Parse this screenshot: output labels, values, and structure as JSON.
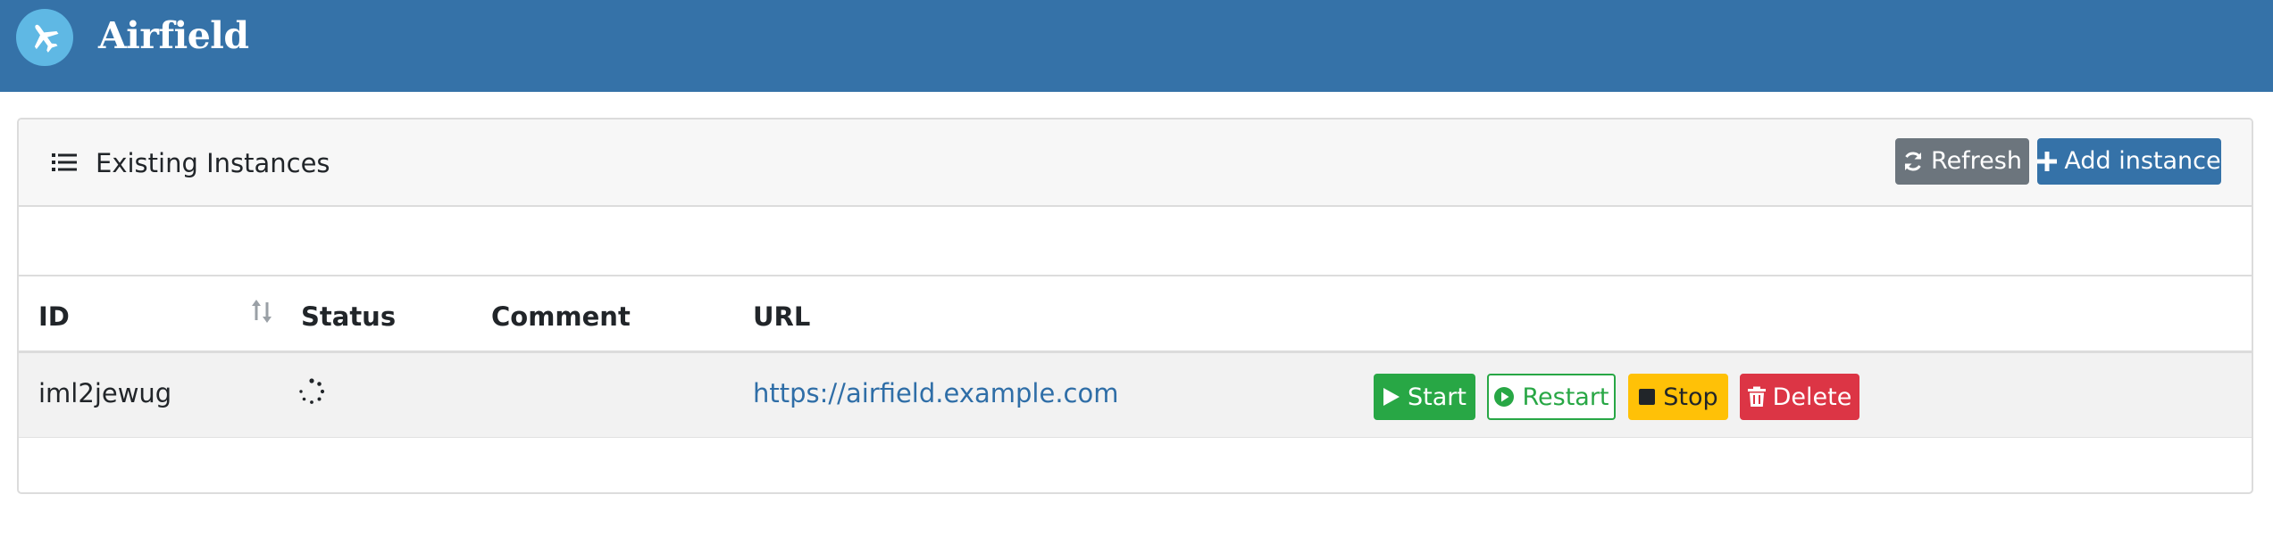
{
  "app": {
    "title": "Airfield",
    "logo_icon": "plane-icon"
  },
  "instances_card": {
    "title": "Existing Instances",
    "title_icon": "list-icon",
    "refresh_label": "Refresh",
    "refresh_icon": "refresh-icon",
    "add_label": "Add instance",
    "add_icon": "plus-icon"
  },
  "table": {
    "columns": [
      "ID",
      "Status",
      "Comment",
      "URL"
    ],
    "sort_icon": "sort-icon",
    "rows": [
      {
        "id": "iml2jewug",
        "status_icon": "loading-spinner-icon",
        "comment": "",
        "url": "https://airfield.example.com",
        "actions": {
          "start": "Start",
          "restart": "Restart",
          "stop": "Stop",
          "delete": "Delete"
        }
      }
    ]
  },
  "colors": {
    "header_bg": "#3572a8",
    "logo_bg": "#5fb8e4",
    "start": "#28a745",
    "stop": "#ffc107",
    "delete": "#dc3545",
    "refresh": "#6c757d",
    "link": "#2f6ea7"
  }
}
